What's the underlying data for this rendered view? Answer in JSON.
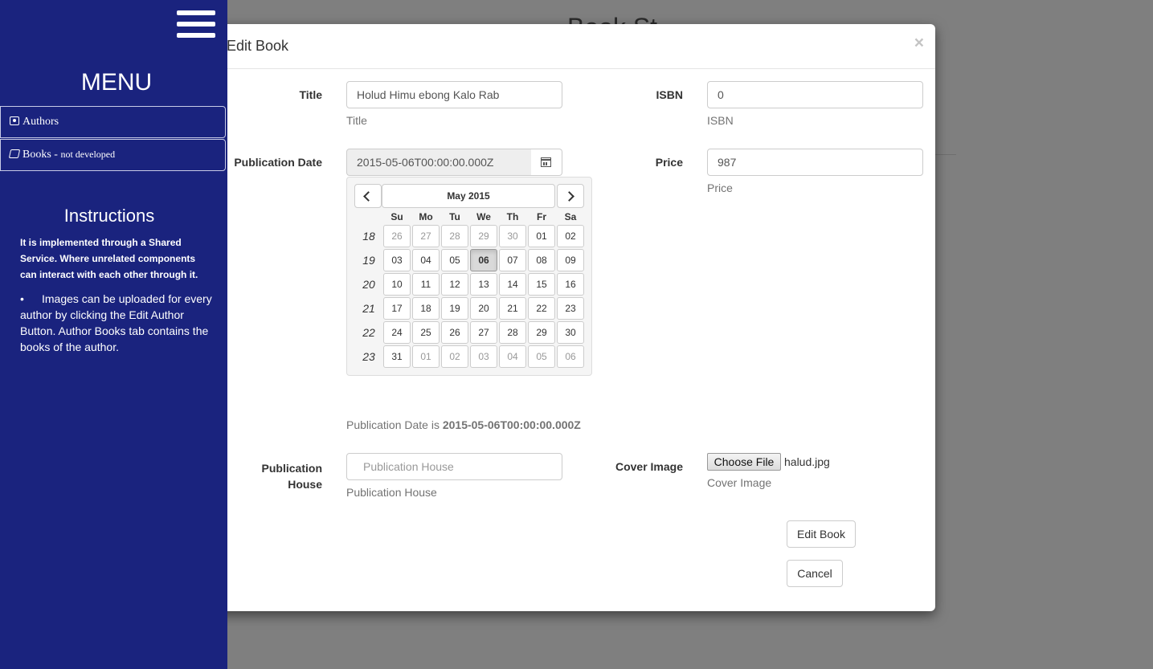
{
  "background": {
    "title": "Book St"
  },
  "sidebar": {
    "menu_title": "MENU",
    "items": [
      {
        "label": "Authors",
        "note": ""
      },
      {
        "label": "Books - ",
        "note": "not developed"
      }
    ],
    "instructions_title": "Instructions",
    "instructions_text": "It is implemented through a Shared Service. Where unrelated components can interact with each other through it.",
    "instructions_list": [
      "Images can be uploaded for every author by clicking the Edit Author Button. Author Books tab contains the books of the author."
    ]
  },
  "modal": {
    "title": "Edit Book",
    "close": "×",
    "fields": {
      "title": {
        "label": "Title",
        "value": "Holud Himu ebong Kalo Rab",
        "help": "Title"
      },
      "isbn": {
        "label": "ISBN",
        "value": "0",
        "help": "ISBN"
      },
      "publication_date": {
        "label": "Publication Date",
        "value": "2015-05-06T00:00:00.000Z"
      },
      "price": {
        "label": "Price",
        "value": "987",
        "help": "Price"
      },
      "publication_house": {
        "label_1": "Publication",
        "label_2": "House",
        "placeholder": "Publication House",
        "help": "Publication House"
      },
      "cover_image": {
        "label": "Cover Image",
        "button": "Choose File",
        "file": "halud.jpg",
        "help": "Cover Image"
      }
    },
    "publication_date_line": {
      "prefix": "Publication Date is ",
      "value": "2015-05-06T00:00:00.000Z"
    },
    "buttons": {
      "edit": "Edit Book",
      "cancel": "Cancel"
    }
  },
  "datepicker": {
    "month_label": "May 2015",
    "days_of_week": [
      "Su",
      "Mo",
      "Tu",
      "We",
      "Th",
      "Fr",
      "Sa"
    ],
    "weeks": [
      {
        "week": "18",
        "days": [
          {
            "d": "26",
            "m": true
          },
          {
            "d": "27",
            "m": true
          },
          {
            "d": "28",
            "m": true
          },
          {
            "d": "29",
            "m": true
          },
          {
            "d": "30",
            "m": true
          },
          {
            "d": "01"
          },
          {
            "d": "02"
          }
        ]
      },
      {
        "week": "19",
        "days": [
          {
            "d": "03"
          },
          {
            "d": "04"
          },
          {
            "d": "05"
          },
          {
            "d": "06",
            "a": true
          },
          {
            "d": "07"
          },
          {
            "d": "08"
          },
          {
            "d": "09"
          }
        ]
      },
      {
        "week": "20",
        "days": [
          {
            "d": "10"
          },
          {
            "d": "11"
          },
          {
            "d": "12"
          },
          {
            "d": "13"
          },
          {
            "d": "14"
          },
          {
            "d": "15"
          },
          {
            "d": "16"
          }
        ]
      },
      {
        "week": "21",
        "days": [
          {
            "d": "17"
          },
          {
            "d": "18"
          },
          {
            "d": "19"
          },
          {
            "d": "20"
          },
          {
            "d": "21"
          },
          {
            "d": "22"
          },
          {
            "d": "23"
          }
        ]
      },
      {
        "week": "22",
        "days": [
          {
            "d": "24"
          },
          {
            "d": "25"
          },
          {
            "d": "26"
          },
          {
            "d": "27"
          },
          {
            "d": "28"
          },
          {
            "d": "29"
          },
          {
            "d": "30"
          }
        ]
      },
      {
        "week": "23",
        "days": [
          {
            "d": "31"
          },
          {
            "d": "01",
            "m": true
          },
          {
            "d": "02",
            "m": true
          },
          {
            "d": "03",
            "m": true
          },
          {
            "d": "04",
            "m": true
          },
          {
            "d": "05",
            "m": true
          },
          {
            "d": "06",
            "m": true
          }
        ]
      }
    ]
  }
}
